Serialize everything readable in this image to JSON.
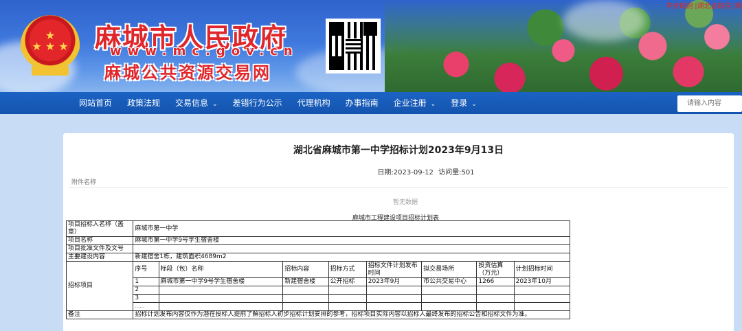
{
  "header": {
    "site_name": "麻城市人民政府",
    "site_url": "www.mc.gov.cn",
    "site_subtitle": "麻城公共资源交易网",
    "top_links": [
      "中央政府",
      "|湖北省政府",
      "|网"
    ]
  },
  "nav": {
    "items": [
      {
        "label": "网站首页",
        "dropdown": false
      },
      {
        "label": "政策法规",
        "dropdown": false
      },
      {
        "label": "交易信息",
        "dropdown": true
      },
      {
        "label": "差错行为公示",
        "dropdown": false
      },
      {
        "label": "代理机构",
        "dropdown": false
      },
      {
        "label": "办事指南",
        "dropdown": false
      },
      {
        "label": "企业注册",
        "dropdown": true
      },
      {
        "label": "登录",
        "dropdown": true
      }
    ],
    "search_placeholder": "请输入内容"
  },
  "article": {
    "title": "湖北省麻城市第一中学招标计划2023年9月13日",
    "date_label": "日期:2023-09-12",
    "views_label": "访问量:501",
    "attachment_label": "附件名称",
    "no_data": "暂无数据",
    "table_title": "麻城市工程建设项目招标计划表"
  },
  "plan_table": {
    "rows": {
      "tenderer_label": "项目招标人名称（盖章）",
      "tenderer_value": "麻城市第一中学",
      "project_name_label": "项目名称",
      "project_name_value": "麻城市第一中学9号学生宿舍楼",
      "approval_label": "项目批准文件及文号",
      "approval_value": "",
      "content_label": "主要建设内容",
      "content_value": "新建宿舍1栋，建筑面积4689m2",
      "items_label": "招标项目",
      "remark_label": "备注",
      "remark_value": "招标计划发布内容仅作为潜在投标人提前了解招标人初步招标计划安排的参考，招标项目实际内容以招标人最终发布的招标公告和招标文件为准。"
    },
    "columns": [
      "序号",
      "标段（包）名称",
      "招标内容",
      "招标方式",
      "招标文件计划发布时间",
      "拟交易场所",
      "投资估算（万元）",
      "计划招标时间"
    ],
    "items": [
      {
        "no": "1",
        "name": "麻城市第一中学9号学生宿舍楼",
        "content": "新建宿舍楼",
        "method": "公开招标",
        "doc_time": "2023年9月",
        "venue": "市公共交易中心",
        "budget": "1266",
        "time": "2023年10月"
      },
      {
        "no": "2",
        "name": "",
        "content": "",
        "method": "",
        "doc_time": "",
        "venue": "",
        "budget": "",
        "time": ""
      },
      {
        "no": "3",
        "name": "",
        "content": "",
        "method": "",
        "doc_time": "",
        "venue": "",
        "budget": "",
        "time": ""
      },
      {
        "no": "……",
        "name": "",
        "content": "",
        "method": "",
        "doc_time": "",
        "venue": "",
        "budget": "",
        "time": ""
      }
    ]
  }
}
